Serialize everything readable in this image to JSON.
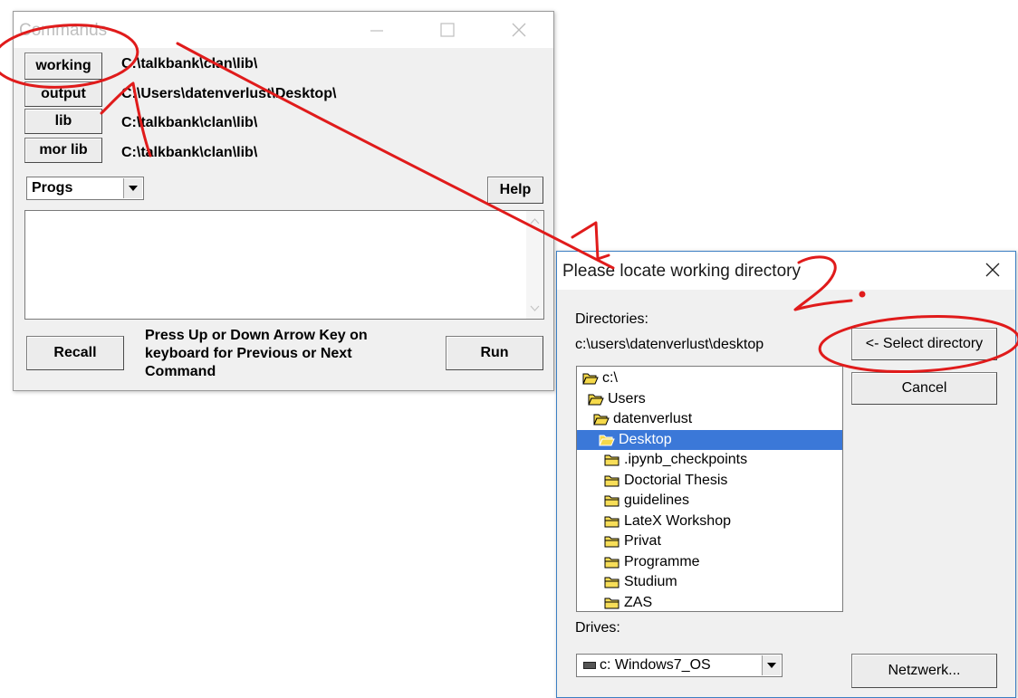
{
  "commands_window": {
    "title": "Commands",
    "buttons": {
      "working": "working",
      "output": "output",
      "lib": "lib",
      "mor_lib": "mor lib",
      "help": "Help",
      "recall": "Recall",
      "run": "Run"
    },
    "paths": {
      "working": "C:\\talkbank\\clan\\lib\\",
      "output": "C:\\Users\\datenverlust\\Desktop\\",
      "lib": "C:\\talkbank\\clan\\lib\\",
      "mor_lib": "C:\\talkbank\\clan\\lib\\"
    },
    "progs_select": "Progs",
    "hint": "Press Up or Down Arrow Key on keyboard for Previous or Next Command",
    "command_text": ""
  },
  "locate_dialog": {
    "title": "Please locate working directory",
    "directories_label": "Directories:",
    "current_path": "c:\\users\\datenverlust\\desktop",
    "select_button": "<- Select directory",
    "cancel_button": "Cancel",
    "tree": [
      {
        "label": "c:\\",
        "indent": 0,
        "open": true,
        "selected": false
      },
      {
        "label": "Users",
        "indent": 1,
        "open": true,
        "selected": false
      },
      {
        "label": "datenverlust",
        "indent": 2,
        "open": true,
        "selected": false
      },
      {
        "label": "Desktop",
        "indent": 3,
        "open": true,
        "selected": true
      },
      {
        "label": ".ipynb_checkpoints",
        "indent": 4,
        "open": false,
        "selected": false
      },
      {
        "label": "Doctorial Thesis",
        "indent": 4,
        "open": false,
        "selected": false
      },
      {
        "label": "guidelines",
        "indent": 4,
        "open": false,
        "selected": false
      },
      {
        "label": "LateX Workshop",
        "indent": 4,
        "open": false,
        "selected": false
      },
      {
        "label": "Privat",
        "indent": 4,
        "open": false,
        "selected": false
      },
      {
        "label": "Programme",
        "indent": 4,
        "open": false,
        "selected": false
      },
      {
        "label": "Studium",
        "indent": 4,
        "open": false,
        "selected": false
      },
      {
        "label": "ZAS",
        "indent": 4,
        "open": false,
        "selected": false
      }
    ],
    "drives_label": "Drives:",
    "drive_value": "c: Windows7_OS",
    "network_button": "Netzwerk..."
  },
  "annotation_color": "#e01b1b"
}
